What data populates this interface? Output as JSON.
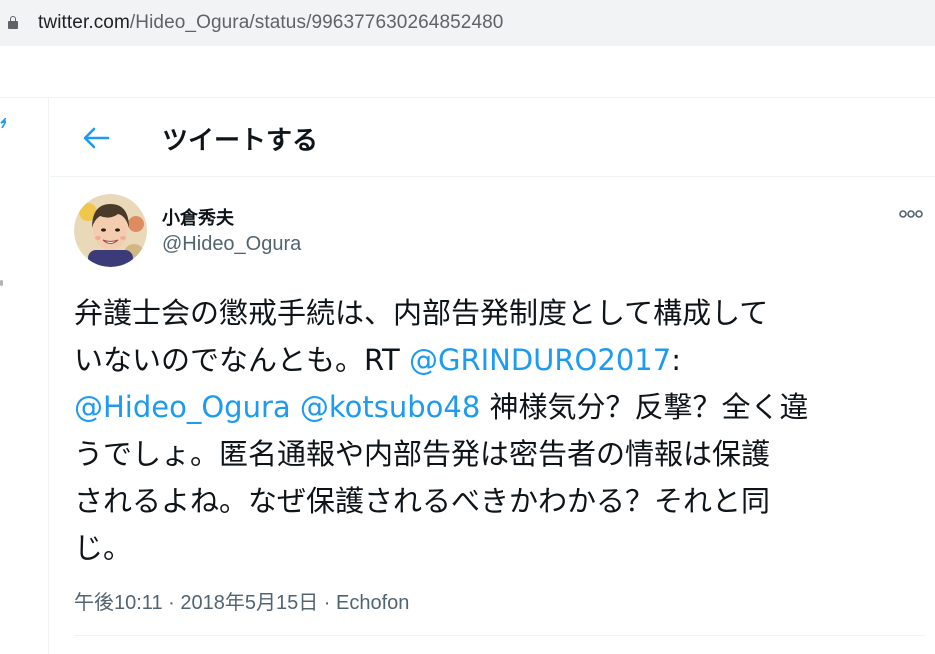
{
  "browser": {
    "url_host": "twitter.com",
    "url_path": "/Hideo_Ogura/status/996377630264852480"
  },
  "header": {
    "title": "ツイートする",
    "back_icon": "arrow-left-icon"
  },
  "tweet": {
    "author": {
      "display_name": "小倉秀夫",
      "handle": "@Hideo_Ogura"
    },
    "more_icon": "ellipsis-icon",
    "text": {
      "l1": "弁護士会の懲戒手続は、内部告発制度として構成して",
      "l2_prefix": "いないのでなんとも。RT ",
      "l2_mention": "@GRINDURO2017",
      "l2_suffix": ":",
      "l3_mention1": "@Hideo_Ogura",
      "l3_space": " ",
      "l3_mention2": "@kotsubo48",
      "l3_suffix": " 神様気分？反撃？全く違",
      "l4": "うでしょ。匿名通報や内部告発は密告者の情報は保護",
      "l5": "されるよね。なぜ保護されるべきかわかる？それと同",
      "l6": "じ。"
    },
    "meta": {
      "time": "午後10:11",
      "sep1": " · ",
      "date": "2018年5月15日",
      "sep2": " · ",
      "source": "Echofon"
    }
  },
  "colors": {
    "accent": "#1d9bf0",
    "text_primary": "#0f1419",
    "text_secondary": "#536471",
    "divider": "#eff3f4",
    "address_bar": "#f1f3f4"
  }
}
